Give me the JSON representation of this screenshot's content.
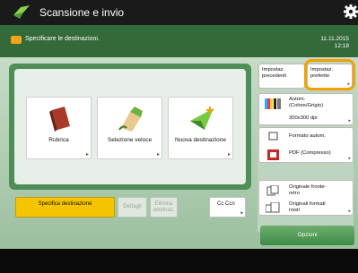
{
  "header": {
    "title": "Scansione e invio"
  },
  "status": {
    "message": "Specificare le destinazioni.",
    "date": "11.11.2015",
    "time": "12:18"
  },
  "destinations": [
    {
      "label": "Rubrica",
      "icon": "address-book-icon"
    },
    {
      "label": "Selezione veloce",
      "icon": "one-touch-icon"
    },
    {
      "label": "Nuova destinazione",
      "icon": "new-destination-icon"
    }
  ],
  "tabs": {
    "specify": "Specifica destinazione",
    "details": "Dettagli",
    "delete": "Elimina destinaz.",
    "cc": "Cc Ccn"
  },
  "right": {
    "prev_settings": "Impostaz. precedenti",
    "favorites": "Impostaz. preferite",
    "color": "Autom. (Colore/Grigio)",
    "resolution": "300x300 dpi",
    "size": "Formato autom.",
    "format": "PDF (Compresso)",
    "sides": "Originale fronte-retro",
    "mixed": "Originali formati misti",
    "options": "Opzioni"
  },
  "colors": {
    "accent": "#f5c400",
    "highlight": "#f5a000",
    "status_bar": "#34693a"
  }
}
